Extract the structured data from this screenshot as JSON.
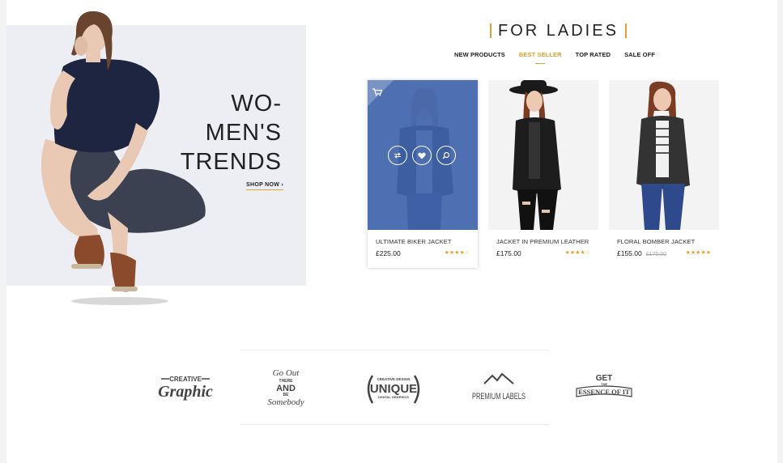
{
  "banner": {
    "title_line1": "WO-",
    "title_line2": "MEN'S",
    "title_line3": "TRENDS",
    "cta": "SHOP NOW ›"
  },
  "section": {
    "title": "FOR LADIES",
    "tabs": [
      {
        "label": "NEW PRODUCTS",
        "active": false
      },
      {
        "label": "BEST SELLER",
        "active": true
      },
      {
        "label": "TOP RATED",
        "active": false
      },
      {
        "label": "SALE OFF",
        "active": false
      }
    ]
  },
  "products": [
    {
      "name": "ULTIMATE BIKER JACKET",
      "price": "£225.00",
      "old_price": "",
      "rating": 4,
      "max_rating": 5,
      "hovered": true
    },
    {
      "name": "JACKET IN PREMIUM LEATHER",
      "price": "£175.00",
      "old_price": "",
      "rating": 4,
      "max_rating": 5,
      "hovered": false
    },
    {
      "name": "FLORAL BOMBER JACKET",
      "price": "£155.00",
      "old_price": "£175.00",
      "rating": 5,
      "max_rating": 5,
      "hovered": false
    }
  ],
  "icons": {
    "cart": "cart-icon",
    "compare": "compare-icon",
    "wishlist": "heart-icon",
    "quickview": "search-icon"
  },
  "brands": {
    "creative": {
      "top": "CREATIVE",
      "main": "Graphic"
    },
    "goout": {
      "line1": "Go Out",
      "line2": "THERE",
      "line3": "AND",
      "line4": "BE",
      "line5": "Somebody"
    },
    "unique": {
      "top": "CREATIVE DESIGN",
      "main": "UNIQUE",
      "bottom": "DIGITAL GRAPHICS"
    },
    "premium": {
      "main": "PREMIUM LABELS"
    },
    "essence": {
      "top": "GET",
      "mid": "THE",
      "main": "ESSENCE OF IT"
    }
  },
  "colors": {
    "accent": "#e0a32e",
    "overlay": "#4064ac",
    "banner_bg": "#eceef4"
  }
}
